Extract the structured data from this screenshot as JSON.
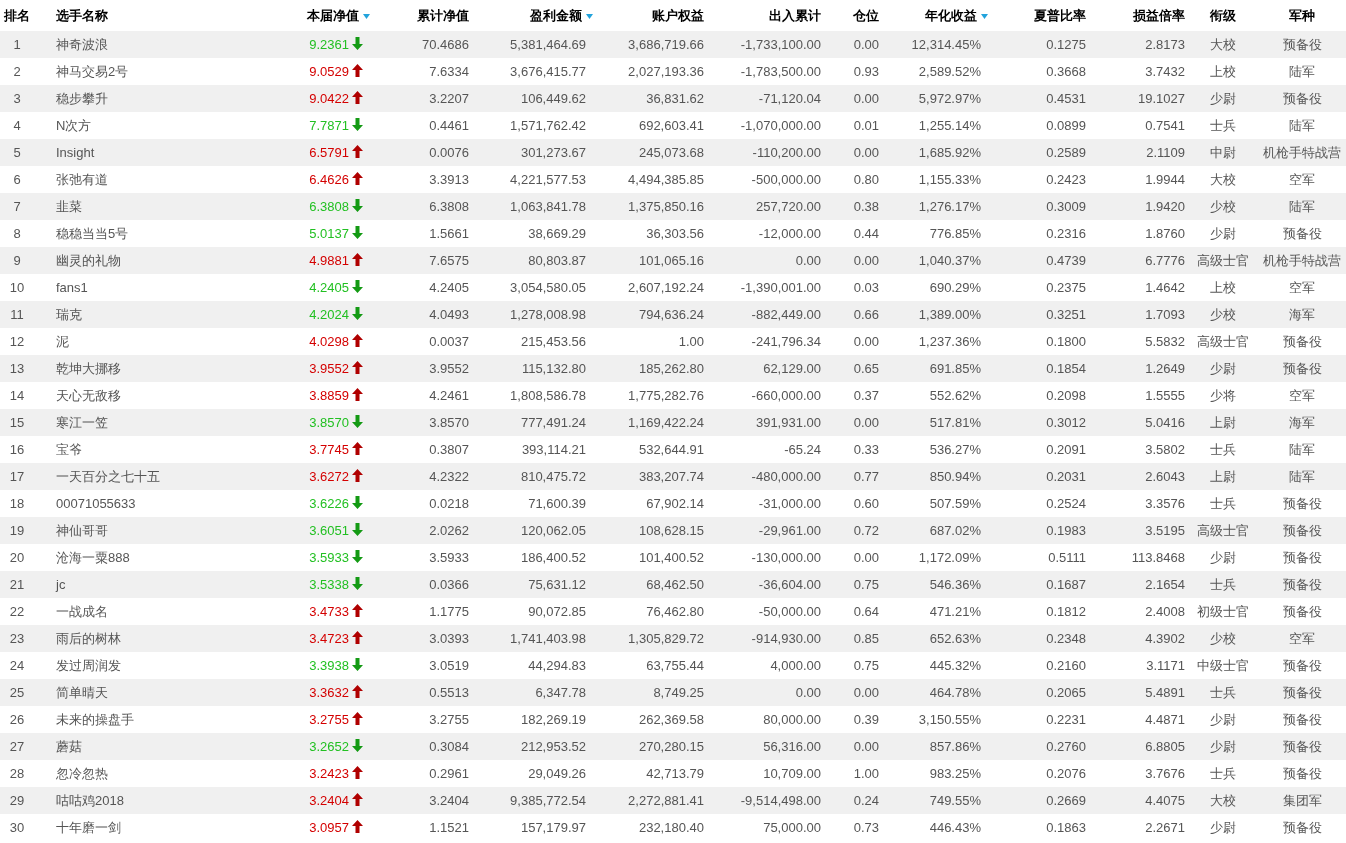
{
  "table": {
    "columns": [
      {
        "label": "排名",
        "kind": "plain"
      },
      {
        "label": "选手名称",
        "kind": "plain"
      },
      {
        "label": "本届净值",
        "kind": "sortable"
      },
      {
        "label": "累计净值",
        "kind": "plain"
      },
      {
        "label": "盈利金额",
        "kind": "sortable"
      },
      {
        "label": "账户权益",
        "kind": "plain"
      },
      {
        "label": "出入累计",
        "kind": "plain"
      },
      {
        "label": "仓位",
        "kind": "plain"
      },
      {
        "label": "年化收益",
        "kind": "sortable"
      },
      {
        "label": "夏普比率",
        "kind": "plain"
      },
      {
        "label": "损益倍率",
        "kind": "plain"
      },
      {
        "label": "衔级",
        "kind": "plain"
      },
      {
        "label": "军种",
        "kind": "plain"
      }
    ],
    "rows": [
      {
        "rising": false,
        "cells": [
          "1",
          "神奇波浪",
          "9.2361",
          "70.4686",
          "5,381,464.69",
          "3,686,719.66",
          "-1,733,100.00",
          "0.00",
          "12,314.45%",
          "0.1275",
          "2.8173",
          "大校",
          "预备役"
        ]
      },
      {
        "rising": true,
        "cells": [
          "2",
          "神马交易2号",
          "9.0529",
          "7.6334",
          "3,676,415.77",
          "2,027,193.36",
          "-1,783,500.00",
          "0.93",
          "2,589.52%",
          "0.3668",
          "3.7432",
          "上校",
          "陆军"
        ]
      },
      {
        "rising": true,
        "cells": [
          "3",
          "稳步攀升",
          "9.0422",
          "3.2207",
          "106,449.62",
          "36,831.62",
          "-71,120.04",
          "0.00",
          "5,972.97%",
          "0.4531",
          "19.1027",
          "少尉",
          "预备役"
        ]
      },
      {
        "rising": false,
        "cells": [
          "4",
          "N次方",
          "7.7871",
          "0.4461",
          "1,571,762.42",
          "692,603.41",
          "-1,070,000.00",
          "0.01",
          "1,255.14%",
          "0.0899",
          "0.7541",
          "士兵",
          "陆军"
        ]
      },
      {
        "rising": true,
        "cells": [
          "5",
          "Insight",
          "6.5791",
          "0.0076",
          "301,273.67",
          "245,073.68",
          "-110,200.00",
          "0.00",
          "1,685.92%",
          "0.2589",
          "2.1109",
          "中尉",
          "机枪手特战营"
        ]
      },
      {
        "rising": true,
        "cells": [
          "6",
          "张弛有道",
          "6.4626",
          "3.3913",
          "4,221,577.53",
          "4,494,385.85",
          "-500,000.00",
          "0.80",
          "1,155.33%",
          "0.2423",
          "1.9944",
          "大校",
          "空军"
        ]
      },
      {
        "rising": false,
        "cells": [
          "7",
          "韭菜",
          "6.3808",
          "6.3808",
          "1,063,841.78",
          "1,375,850.16",
          "257,720.00",
          "0.38",
          "1,276.17%",
          "0.3009",
          "1.9420",
          "少校",
          "陆军"
        ]
      },
      {
        "rising": false,
        "cells": [
          "8",
          "稳稳当当5号",
          "5.0137",
          "1.5661",
          "38,669.29",
          "36,303.56",
          "-12,000.00",
          "0.44",
          "776.85%",
          "0.2316",
          "1.8760",
          "少尉",
          "预备役"
        ]
      },
      {
        "rising": true,
        "cells": [
          "9",
          "幽灵的礼物",
          "4.9881",
          "7.6575",
          "80,803.87",
          "101,065.16",
          "0.00",
          "0.00",
          "1,040.37%",
          "0.4739",
          "6.7776",
          "高级士官",
          "机枪手特战营"
        ]
      },
      {
        "rising": false,
        "cells": [
          "10",
          "fans1",
          "4.2405",
          "4.2405",
          "3,054,580.05",
          "2,607,192.24",
          "-1,390,001.00",
          "0.03",
          "690.29%",
          "0.2375",
          "1.4642",
          "上校",
          "空军"
        ]
      },
      {
        "rising": false,
        "cells": [
          "11",
          "瑞克",
          "4.2024",
          "4.0493",
          "1,278,008.98",
          "794,636.24",
          "-882,449.00",
          "0.66",
          "1,389.00%",
          "0.3251",
          "1.7093",
          "少校",
          "海军"
        ]
      },
      {
        "rising": true,
        "cells": [
          "12",
          "泥",
          "4.0298",
          "0.0037",
          "215,453.56",
          "1.00",
          "-241,796.34",
          "0.00",
          "1,237.36%",
          "0.1800",
          "5.5832",
          "高级士官",
          "预备役"
        ]
      },
      {
        "rising": true,
        "cells": [
          "13",
          "乾坤大挪移",
          "3.9552",
          "3.9552",
          "115,132.80",
          "185,262.80",
          "62,129.00",
          "0.65",
          "691.85%",
          "0.1854",
          "1.2649",
          "少尉",
          "预备役"
        ]
      },
      {
        "rising": true,
        "cells": [
          "14",
          "天心无敌移",
          "3.8859",
          "4.2461",
          "1,808,586.78",
          "1,775,282.76",
          "-660,000.00",
          "0.37",
          "552.62%",
          "0.2098",
          "1.5555",
          "少将",
          "空军"
        ]
      },
      {
        "rising": false,
        "cells": [
          "15",
          "寒江一笠",
          "3.8570",
          "3.8570",
          "777,491.24",
          "1,169,422.24",
          "391,931.00",
          "0.00",
          "517.81%",
          "0.3012",
          "5.0416",
          "上尉",
          "海军"
        ]
      },
      {
        "rising": true,
        "cells": [
          "16",
          "宝爷",
          "3.7745",
          "0.3807",
          "393,114.21",
          "532,644.91",
          "-65.24",
          "0.33",
          "536.27%",
          "0.2091",
          "3.5802",
          "士兵",
          "陆军"
        ]
      },
      {
        "rising": true,
        "cells": [
          "17",
          "一天百分之七十五",
          "3.6272",
          "4.2322",
          "810,475.72",
          "383,207.74",
          "-480,000.00",
          "0.77",
          "850.94%",
          "0.2031",
          "2.6043",
          "上尉",
          "陆军"
        ]
      },
      {
        "rising": false,
        "cells": [
          "18",
          "00071055633",
          "3.6226",
          "0.0218",
          "71,600.39",
          "67,902.14",
          "-31,000.00",
          "0.60",
          "507.59%",
          "0.2524",
          "3.3576",
          "士兵",
          "预备役"
        ]
      },
      {
        "rising": false,
        "cells": [
          "19",
          "神仙哥哥",
          "3.6051",
          "2.0262",
          "120,062.05",
          "108,628.15",
          "-29,961.00",
          "0.72",
          "687.02%",
          "0.1983",
          "3.5195",
          "高级士官",
          "预备役"
        ]
      },
      {
        "rising": false,
        "cells": [
          "20",
          "沧海一粟888",
          "3.5933",
          "3.5933",
          "186,400.52",
          "101,400.52",
          "-130,000.00",
          "0.00",
          "1,172.09%",
          "0.5111",
          "113.8468",
          "少尉",
          "预备役"
        ]
      },
      {
        "rising": false,
        "cells": [
          "21",
          "jc",
          "3.5338",
          "0.0366",
          "75,631.12",
          "68,462.50",
          "-36,604.00",
          "0.75",
          "546.36%",
          "0.1687",
          "2.1654",
          "士兵",
          "预备役"
        ]
      },
      {
        "rising": true,
        "cells": [
          "22",
          "一战成名",
          "3.4733",
          "1.1775",
          "90,072.85",
          "76,462.80",
          "-50,000.00",
          "0.64",
          "471.21%",
          "0.1812",
          "2.4008",
          "初级士官",
          "预备役"
        ]
      },
      {
        "rising": true,
        "cells": [
          "23",
          "雨后的树林",
          "3.4723",
          "3.0393",
          "1,741,403.98",
          "1,305,829.72",
          "-914,930.00",
          "0.85",
          "652.63%",
          "0.2348",
          "4.3902",
          "少校",
          "空军"
        ]
      },
      {
        "rising": false,
        "cells": [
          "24",
          "发过周润发",
          "3.3938",
          "3.0519",
          "44,294.83",
          "63,755.44",
          "4,000.00",
          "0.75",
          "445.32%",
          "0.2160",
          "3.1171",
          "中级士官",
          "预备役"
        ]
      },
      {
        "rising": true,
        "cells": [
          "25",
          "简单晴天",
          "3.3632",
          "0.5513",
          "6,347.78",
          "8,749.25",
          "0.00",
          "0.00",
          "464.78%",
          "0.2065",
          "5.4891",
          "士兵",
          "预备役"
        ]
      },
      {
        "rising": true,
        "cells": [
          "26",
          "未来的操盘手",
          "3.2755",
          "3.2755",
          "182,269.19",
          "262,369.58",
          "80,000.00",
          "0.39",
          "3,150.55%",
          "0.2231",
          "4.4871",
          "少尉",
          "预备役"
        ]
      },
      {
        "rising": false,
        "cells": [
          "27",
          "蘑菇",
          "3.2652",
          "0.3084",
          "212,953.52",
          "270,280.15",
          "56,316.00",
          "0.00",
          "857.86%",
          "0.2760",
          "6.8805",
          "少尉",
          "预备役"
        ]
      },
      {
        "rising": true,
        "cells": [
          "28",
          "忽冷忽热",
          "3.2423",
          "0.2961",
          "29,049.26",
          "42,713.79",
          "10,709.00",
          "1.00",
          "983.25%",
          "0.2076",
          "3.7676",
          "士兵",
          "预备役"
        ]
      },
      {
        "rising": true,
        "cells": [
          "29",
          "咕咕鸡2018",
          "3.2404",
          "3.2404",
          "9,385,772.54",
          "2,272,881.41",
          "-9,514,498.00",
          "0.24",
          "749.55%",
          "0.2669",
          "4.4075",
          "大校",
          "集团军"
        ]
      },
      {
        "rising": true,
        "cells": [
          "30",
          "十年磨一剑",
          "3.0957",
          "1.1521",
          "157,179.97",
          "232,180.40",
          "75,000.00",
          "0.73",
          "446.43%",
          "0.1863",
          "2.2671",
          "少尉",
          "预备役"
        ]
      }
    ]
  }
}
